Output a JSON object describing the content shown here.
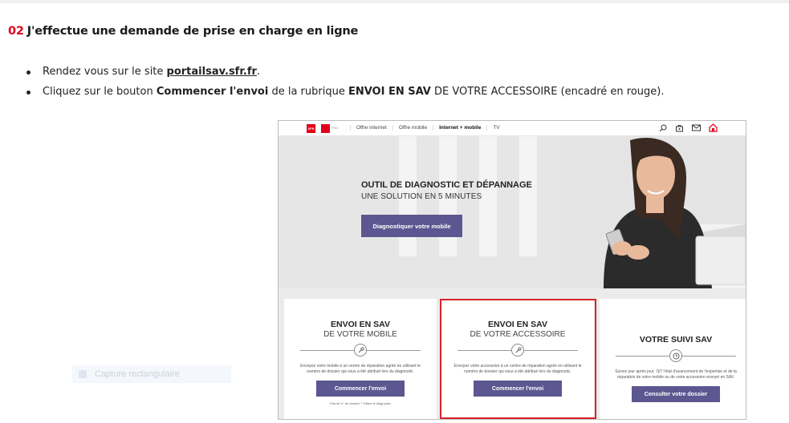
{
  "heading": {
    "number": "02",
    "text": "J'effectue une demande de prise en charge en ligne"
  },
  "bullets": [
    {
      "pre": "Rendez vous sur le site ",
      "link": "portailsav.sfr.fr",
      "post": "."
    },
    {
      "pre": "Cliquez sur le bouton ",
      "bold1": "Commencer l'envoi",
      "mid": " de la rubrique ",
      "bold2": "ENVOI EN SAV",
      "post": " DE VOTRE ACCESSOIRE (encadré en rouge)."
    }
  ],
  "screenshot": {
    "logo_text": "SFR",
    "logo_pro": "PRO",
    "nav_links": [
      "Offre internet",
      "Offre mobile",
      "Internet + mobile",
      "TV"
    ],
    "nav_icons": [
      "search-icon",
      "cart-icon",
      "mail-icon",
      "home-icon"
    ],
    "hero": {
      "title": "OUTIL DE DIAGNOSTIC ET DÉPANNAGE",
      "subtitle": "UNE SOLUTION EN 5 MINUTES",
      "button": "Diagnostiquer votre mobile"
    },
    "cards": [
      {
        "title": "ENVOI EN SAV",
        "subtitle": "DE VOTRE MOBILE",
        "icon": "wrench-icon",
        "desc": "Envoyez votre mobile à un centre de réparation agréé en utilisant le numéro de dossier qui vous a été attribué lors du diagnostic.",
        "button": "Commencer l'envoi",
        "link": "Pas de n° de dossier ? Faites le diagnostic"
      },
      {
        "title": "ENVOI EN SAV",
        "subtitle": "DE VOTRE ACCESSOIRE",
        "icon": "wrench-icon",
        "desc": "Envoyez votre accessoire à un centre de réparation agréé en utilisant le numéro de dossier qui vous a été attribué lors du diagnostic.",
        "button": "Commencer l'envoi",
        "link": ""
      },
      {
        "title": "VOTRE SUIVI SAV",
        "subtitle": "",
        "icon": "clock-icon",
        "desc": "Suivez jour après jour, 7j/7 l'état d'avancement de l'expertise et de la réparation de votre mobile ou de votre accessoire envoyé en SAV.",
        "button": "Consulter votre dossier",
        "link": ""
      }
    ]
  },
  "ghost_overlay": {
    "label": "Capture rectangulaire"
  },
  "colors": {
    "accent_red": "#e2001a",
    "button_purple": "#5c5790",
    "highlight_box": "#d8232a"
  }
}
